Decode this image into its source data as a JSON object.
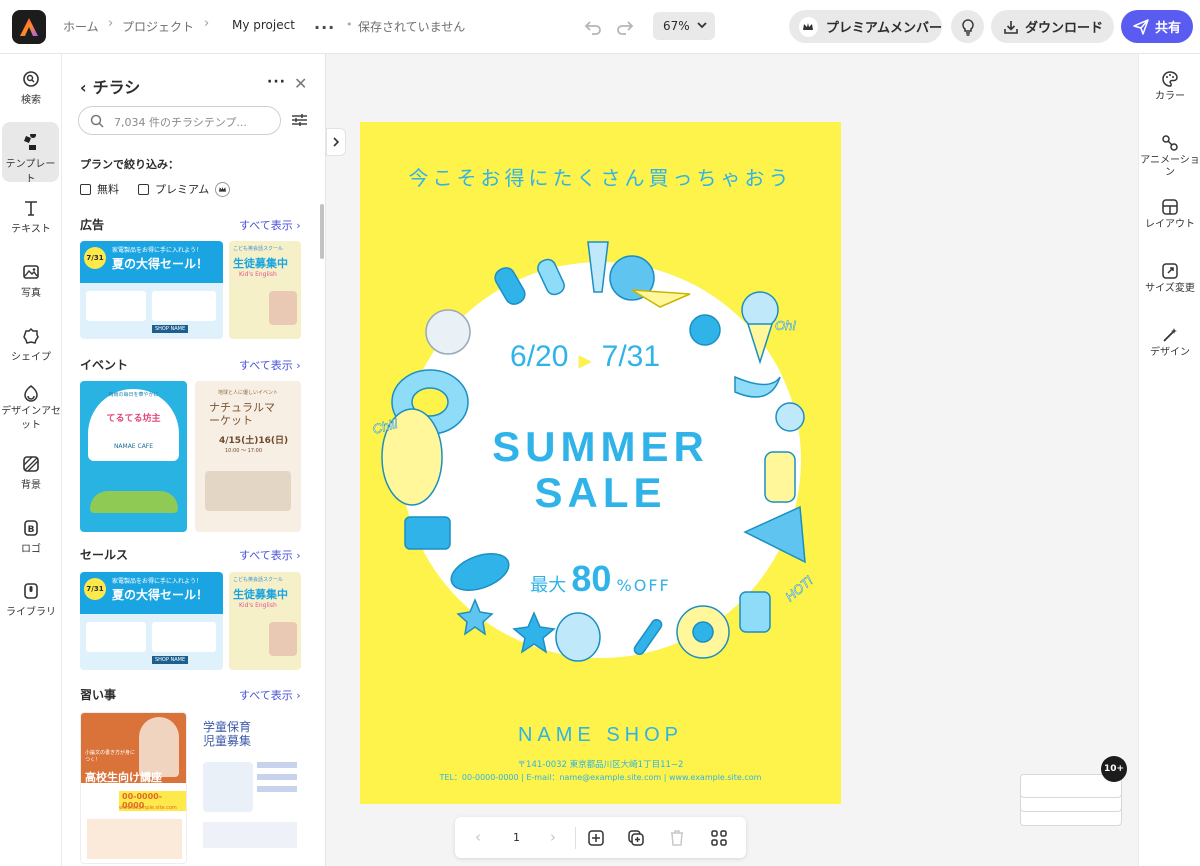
{
  "colors": {
    "accent": "#5a5bf0",
    "poster_bg": "#fdf34a",
    "poster_blue": "#2fb3e8",
    "link": "#4a53d8"
  },
  "topbar": {
    "breadcrumb": [
      "ホーム",
      "プロジェクト",
      "My project"
    ],
    "more_icon": "...",
    "save_status": "保存されていません",
    "zoom": "67%",
    "premium_label": "プレミアムメンバー",
    "download_label": "ダウンロード",
    "share_label": "共有"
  },
  "left_rail": {
    "items": [
      {
        "label": "検索",
        "icon": "search-icon"
      },
      {
        "label": "テンプレート",
        "icon": "template-icon"
      },
      {
        "label": "テキスト",
        "icon": "text-icon"
      },
      {
        "label": "写真",
        "icon": "photo-icon"
      },
      {
        "label": "シェイプ",
        "icon": "shape-icon"
      },
      {
        "label": "デザインアセット",
        "icon": "design-asset-icon"
      },
      {
        "label": "背景",
        "icon": "background-icon"
      },
      {
        "label": "ロゴ",
        "icon": "logo-icon"
      },
      {
        "label": "ライブラリ",
        "icon": "library-icon"
      }
    ]
  },
  "panel": {
    "title": "チラシ",
    "search_placeholder": "7,034 件のチラシテンプ...",
    "filter_label": "プランで絞り込み：",
    "filter_free": "無料",
    "filter_premium": "プレミアム",
    "see_all": "すべて表示",
    "sections": [
      {
        "title": "広告",
        "thumbs": [
          {
            "date": "7/31",
            "headline": "家電製品をお得に手に入れよう！",
            "main": "夏の大得セール！",
            "tag": "SHOP NAME"
          },
          {
            "main": "生徒募集中",
            "sub": "こども英会話スクール",
            "en": "Kid's English"
          }
        ]
      },
      {
        "title": "イベント",
        "thumbs": [
          {
            "sub": "梅雨の毎日を華やかに",
            "main": "てるてる坊主",
            "tag": "NAMAE CAFE"
          },
          {
            "sub": "地球と人に優しいイベント",
            "main": "ナチュラルマーケット",
            "date": "4/15",
            "time": "16",
            "hours": "10:00 ～ 17:00"
          }
        ]
      },
      {
        "title": "セールス",
        "thumbs": [
          {
            "date": "7/31",
            "headline": "家電製品をお得に手に入れよう！",
            "main": "夏の大得セール！",
            "tag": "SHOP NAME"
          },
          {
            "main": "生徒募集中",
            "sub": "こども英会話スクール",
            "en": "Kid's English"
          }
        ]
      },
      {
        "title": "習い事",
        "thumbs": [
          {
            "sub": "小論文の書き方が身につく！",
            "main": "高校生向け講座",
            "phone": "00-0000-0000",
            "url": "www.example.site.com"
          },
          {
            "main1": "学童保育",
            "main2": "児童募集"
          }
        ]
      }
    ]
  },
  "poster": {
    "tagline": "今こそお得にたくさん買っちゃおう",
    "date_from_month": "6",
    "date_from_day": "20",
    "date_to_month": "7",
    "date_to_day": "31",
    "title_line1": "SUMMER",
    "title_line2": "SALE",
    "discount_prefix": "最大",
    "discount_value": "80",
    "discount_suffix": "%OFF",
    "shop_name": "NAME SHOP",
    "address": "〒141-0032 東京都品川区大崎1丁目11−2",
    "contact": "TEL：00-0000-0000 | E-mail：name@example.site.com | www.example.site.com",
    "deco_words": [
      "Chill",
      "Oh!",
      "HOT!"
    ]
  },
  "page_bar": {
    "page": "1"
  },
  "right_rail": {
    "items": [
      {
        "label": "カラー",
        "icon": "palette-icon"
      },
      {
        "label": "アニメーション",
        "icon": "animation-icon"
      },
      {
        "label": "レイアウト",
        "icon": "layout-icon"
      },
      {
        "label": "サイズ変更",
        "icon": "resize-icon"
      },
      {
        "label": "デザイン",
        "icon": "magic-wand-icon"
      }
    ]
  },
  "pages_badge": "10+"
}
